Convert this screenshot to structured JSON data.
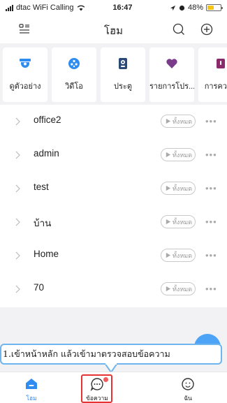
{
  "status_bar": {
    "carrier": "dtac WiFi Calling",
    "time": "16:47",
    "battery_text": "48%",
    "battery_level": 0.48
  },
  "header": {
    "title": "โฮม"
  },
  "categories": [
    {
      "label": "ดูตัวอย่าง",
      "icon": "camera-icon"
    },
    {
      "label": "วิดีโอ",
      "icon": "video-icon"
    },
    {
      "label": "ประตู",
      "icon": "doorbell-icon"
    },
    {
      "label": "รายการโปร...",
      "icon": "heart-icon"
    },
    {
      "label": "การควบคุ",
      "icon": "control-icon"
    }
  ],
  "groups": [
    {
      "name": "office2",
      "pill": "ทั้งหมด"
    },
    {
      "name": "admin",
      "pill": "ทั้งหมด"
    },
    {
      "name": "test",
      "pill": "ทั้งหมด"
    },
    {
      "name": "บ้าน",
      "pill": "ทั้งหมด"
    },
    {
      "name": "Home",
      "pill": "ทั้งหมด"
    },
    {
      "name": "70",
      "pill": "ทั้งหมด"
    }
  ],
  "callout": {
    "text": "1.เข้าหน้าหลัก แล้วเข้ามาตรวจสอบข้อความ"
  },
  "tabs": [
    {
      "label": "โฮม",
      "icon": "home-icon",
      "active": true
    },
    {
      "label": "ข้อความ",
      "icon": "message-icon",
      "active": false
    },
    {
      "label": "ฉัน",
      "icon": "profile-icon",
      "active": false
    }
  ],
  "colors": {
    "accent": "#2f8cf0",
    "highlight": "#e63232",
    "badge": "#f05a5a"
  }
}
